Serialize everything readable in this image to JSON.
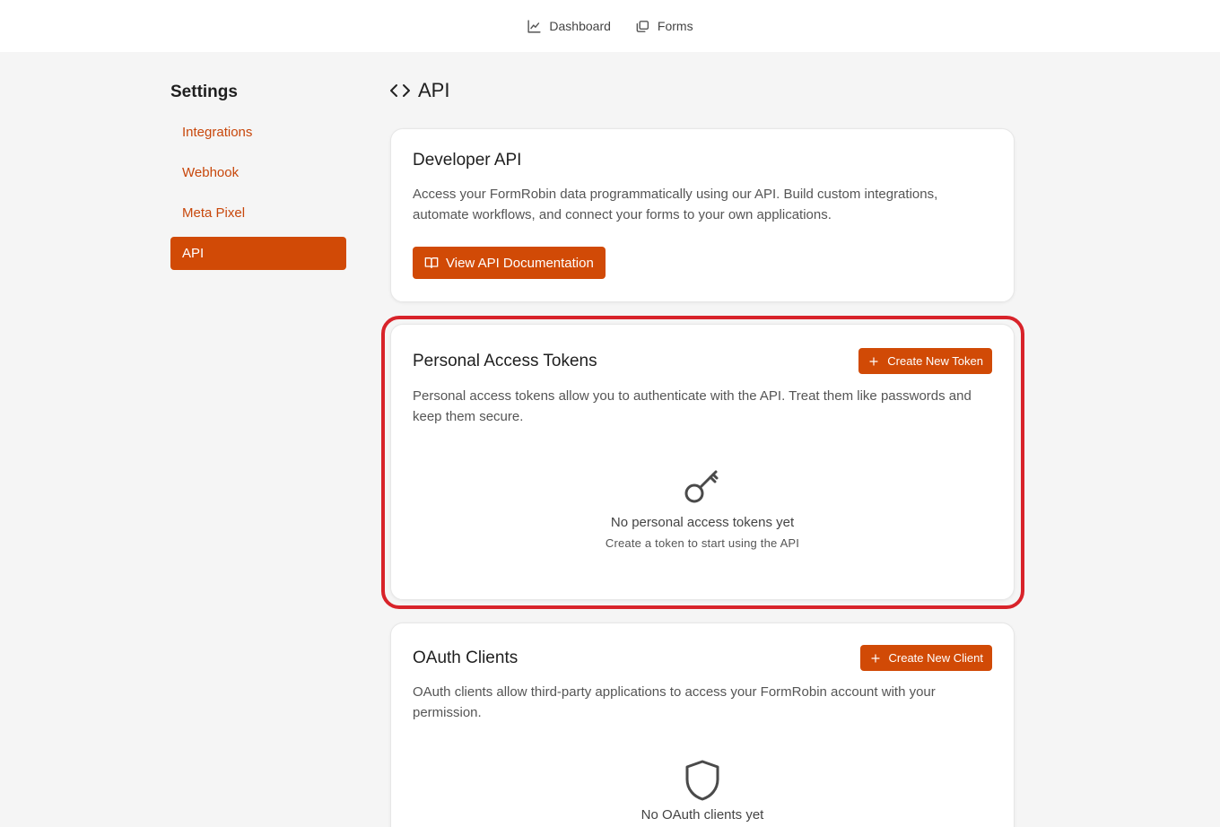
{
  "nav": {
    "dashboard": "Dashboard",
    "forms": "Forms"
  },
  "sidebar": {
    "title": "Settings",
    "items": [
      {
        "label": "Integrations"
      },
      {
        "label": "Webhook"
      },
      {
        "label": "Meta Pixel"
      },
      {
        "label": "API",
        "active": true
      }
    ]
  },
  "page": {
    "title": "API",
    "icon": "code-icon"
  },
  "developer_api": {
    "title": "Developer API",
    "description": "Access your FormRobin data programmatically using our API. Build custom integrations, automate workflows, and connect your forms to your own applications.",
    "button_label": "View API Documentation"
  },
  "tokens": {
    "title": "Personal Access Tokens",
    "button_label": "Create New Token",
    "description": "Personal access tokens allow you to authenticate with the API. Treat them like passwords and keep them secure.",
    "empty_title": "No personal access tokens yet",
    "empty_subtitle": "Create a token to start using the API"
  },
  "oauth": {
    "title": "OAuth Clients",
    "button_label": "Create New Client",
    "description": "OAuth clients allow third-party applications to access your FormRobin account with your permission.",
    "empty_title": "No OAuth clients yet"
  },
  "colors": {
    "accent": "#d14a06",
    "highlight": "#d8232a"
  }
}
